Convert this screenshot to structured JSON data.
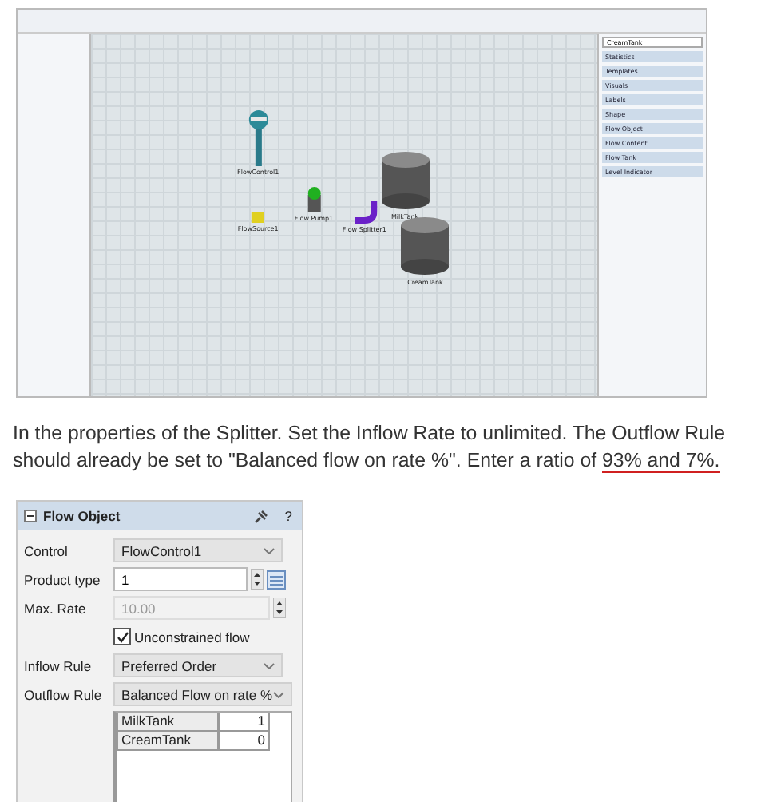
{
  "screenshot": {
    "nodes": [
      {
        "label": "FlowControl1",
        "kind": "control"
      },
      {
        "label": "FlowSource1",
        "kind": "source"
      },
      {
        "label": "Flow Pump1",
        "kind": "pump"
      },
      {
        "label": "Flow Splitter1",
        "kind": "splitter"
      },
      {
        "label": "MilkTank",
        "kind": "tank"
      },
      {
        "label": "CreamTank",
        "kind": "tank"
      }
    ],
    "properties": {
      "name": "CreamTank",
      "sections": [
        "Statistics",
        "Templates",
        "Visuals",
        "Labels",
        "Shape",
        "Flow Object",
        "Flow Content",
        "Flow Tank",
        "Level Indicator"
      ]
    }
  },
  "paragraph": {
    "text": "In the properties of the Splitter. Set the Inflow Rate to unlimited. The Outflow Rule should already be set to \"Balanced flow on rate %\". Enter a ratio of ",
    "underlined": "93% and 7%."
  },
  "panel": {
    "title": "Flow Object",
    "help": "?",
    "rows": [
      {
        "kind": "dropdown",
        "label": "Control",
        "value": "FlowControl1",
        "disabled": false
      },
      {
        "kind": "spinner",
        "label": "Product type",
        "value": "1",
        "disabled": false
      },
      {
        "kind": "spinner",
        "label": "Max. Rate",
        "value": "10.00",
        "disabled": true
      },
      {
        "kind": "checkbox",
        "label": "Unconstrained flow",
        "checked": true
      },
      {
        "kind": "dropdown",
        "label": "Inflow Rule",
        "value": "Preferred Order",
        "disabled": false
      },
      {
        "kind": "dropdown",
        "label": "Outflow Rule",
        "value": "Balanced Flow on rate %",
        "disabled": false
      }
    ],
    "table": [
      {
        "name": "MilkTank",
        "value": "1"
      },
      {
        "name": "CreamTank",
        "value": "0"
      }
    ]
  }
}
